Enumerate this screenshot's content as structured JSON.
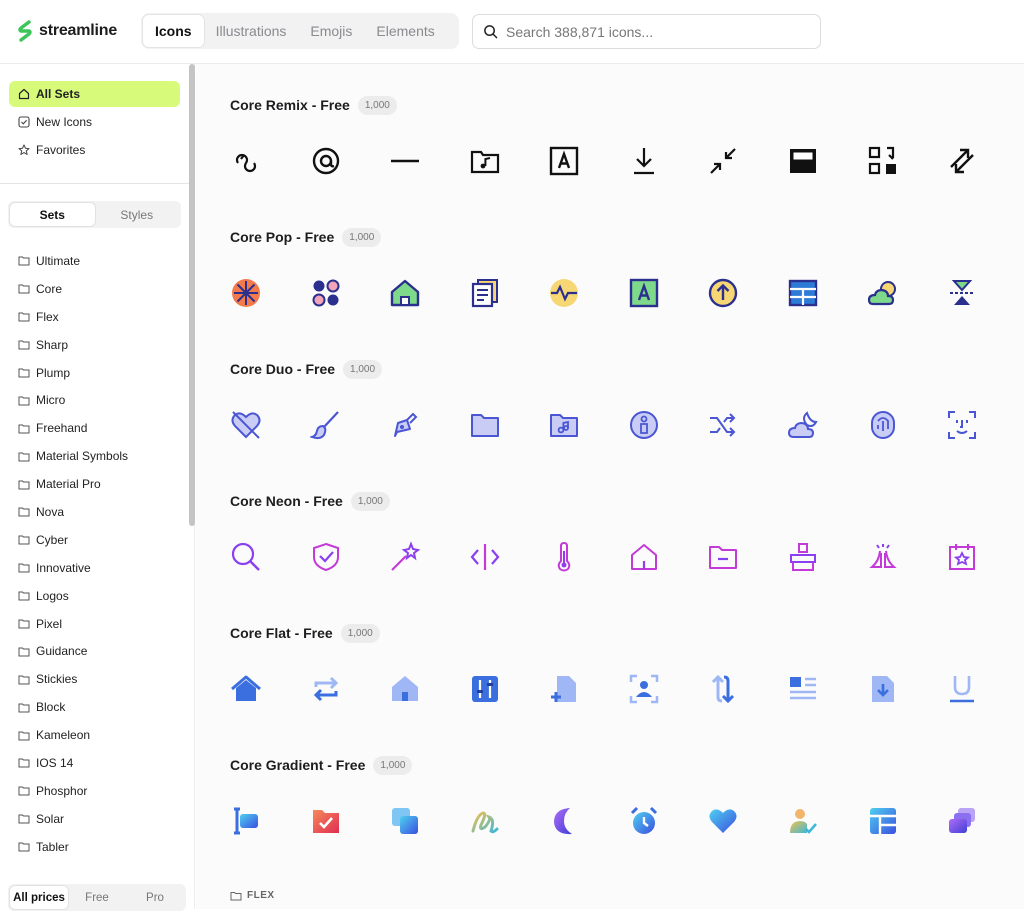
{
  "app": {
    "brand": "streamline",
    "brand_color": "#3dc55a"
  },
  "header": {
    "tabs": [
      {
        "label": "Icons",
        "active": true
      },
      {
        "label": "Illustrations",
        "active": false
      },
      {
        "label": "Emojis",
        "active": false
      },
      {
        "label": "Elements",
        "active": false
      }
    ],
    "search": {
      "placeholder": "Search 388,871 icons..."
    }
  },
  "sidebar": {
    "nav": [
      {
        "label": "All Sets",
        "icon": "home-icon",
        "active": true
      },
      {
        "label": "New Icons",
        "icon": "checkbox-icon",
        "active": false
      },
      {
        "label": "Favorites",
        "icon": "star-icon",
        "active": false
      }
    ],
    "toggle": {
      "sets": "Sets",
      "styles": "Styles"
    },
    "sets": [
      "Ultimate",
      "Core",
      "Flex",
      "Sharp",
      "Plump",
      "Micro",
      "Freehand",
      "Material Symbols",
      "Material Pro",
      "Nova",
      "Cyber",
      "Innovative",
      "Logos",
      "Pixel",
      "Guidance",
      "Stickies",
      "Block",
      "Kameleon",
      "IOS 14",
      "Phosphor",
      "Solar",
      "Tabler"
    ],
    "prices": {
      "all": "All prices",
      "free": "Free",
      "pro": "Pro"
    },
    "accent": "#d8fa7a"
  },
  "main": {
    "sections": [
      {
        "title": "Core Remix - Free",
        "count": "1,000",
        "style": "remix"
      },
      {
        "title": "Core Pop - Free",
        "count": "1,000",
        "style": "pop"
      },
      {
        "title": "Core Duo - Free",
        "count": "1,000",
        "style": "duo"
      },
      {
        "title": "Core Neon - Free",
        "count": "1,000",
        "style": "neon"
      },
      {
        "title": "Core Flat - Free",
        "count": "1,000",
        "style": "flat"
      },
      {
        "title": "Core Gradient - Free",
        "count": "1,000",
        "style": "gradient"
      }
    ],
    "footer_label": "FLEX"
  }
}
